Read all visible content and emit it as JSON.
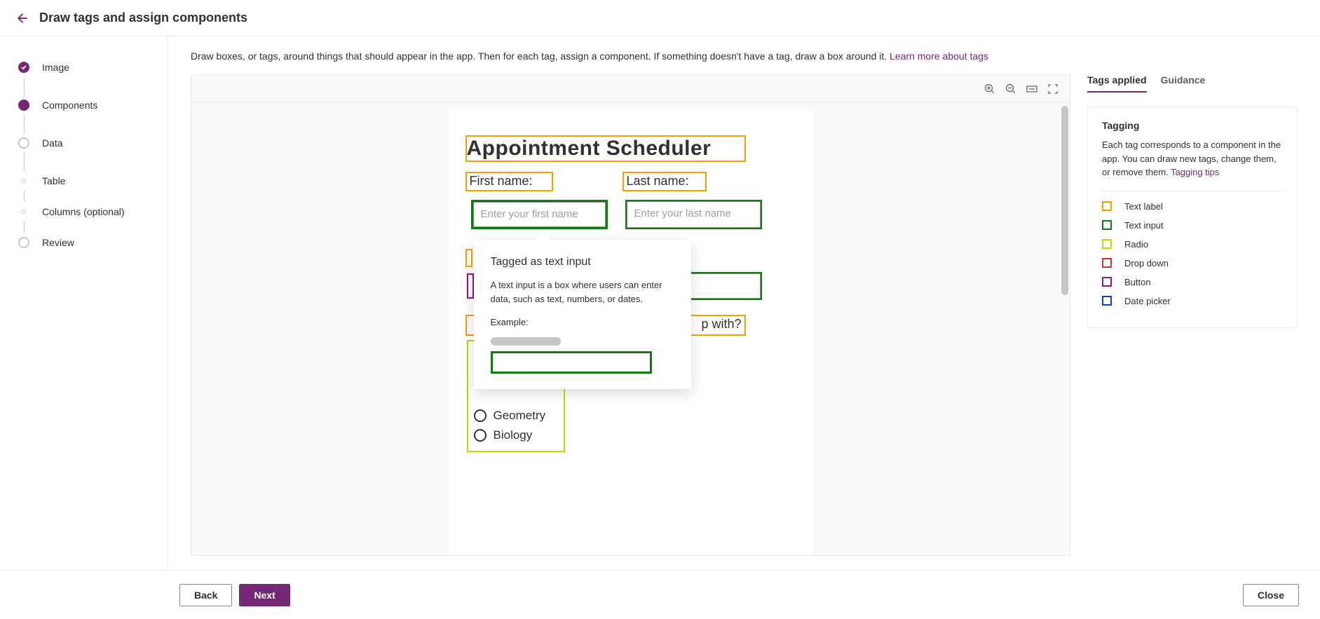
{
  "header": {
    "title": "Draw tags and assign components"
  },
  "wizard": {
    "steps": [
      {
        "label": "Image",
        "state": "completed"
      },
      {
        "label": "Components",
        "state": "current"
      },
      {
        "label": "Data",
        "state": "pending"
      },
      {
        "label": "Table",
        "state": "sub"
      },
      {
        "label": "Columns (optional)",
        "state": "sub"
      },
      {
        "label": "Review",
        "state": "pending"
      }
    ]
  },
  "instruction": {
    "text": "Draw boxes, or tags, around things that should appear in the app. Then for each tag, assign a component. If something doesn't have a tag, draw a box around it. ",
    "link": "Learn more about tags"
  },
  "canvas": {
    "form_title": "Appointment Scheduler",
    "first_name_label": "First name:",
    "first_name_placeholder": "Enter your first name",
    "last_name_label": "Last name:",
    "last_name_placeholder": "Enter your last name",
    "help_with_fragment": "p with?",
    "radio_options": [
      "Geometry",
      "Biology"
    ]
  },
  "tooltip": {
    "title": "Tagged as text input",
    "description": "A text input is a box where users can enter data, such as text, numbers, or dates.",
    "example_label": "Example:"
  },
  "tabs": {
    "applied": "Tags applied",
    "guidance": "Guidance"
  },
  "tagging_panel": {
    "heading": "Tagging",
    "body": "Each tag corresponds to a component in the app. You can draw new tags, change them, or remove them. ",
    "link": "Tagging tips",
    "legend": [
      {
        "label": "Text label",
        "color": "#f2a100"
      },
      {
        "label": "Text input",
        "color": "#107c10"
      },
      {
        "label": "Radio",
        "color": "#c4d600"
      },
      {
        "label": "Drop down",
        "color": "#d13438"
      },
      {
        "label": "Button",
        "color": "#881798"
      },
      {
        "label": "Date picker",
        "color": "#0b3bbf"
      }
    ]
  },
  "footer": {
    "back": "Back",
    "next": "Next",
    "close": "Close"
  }
}
